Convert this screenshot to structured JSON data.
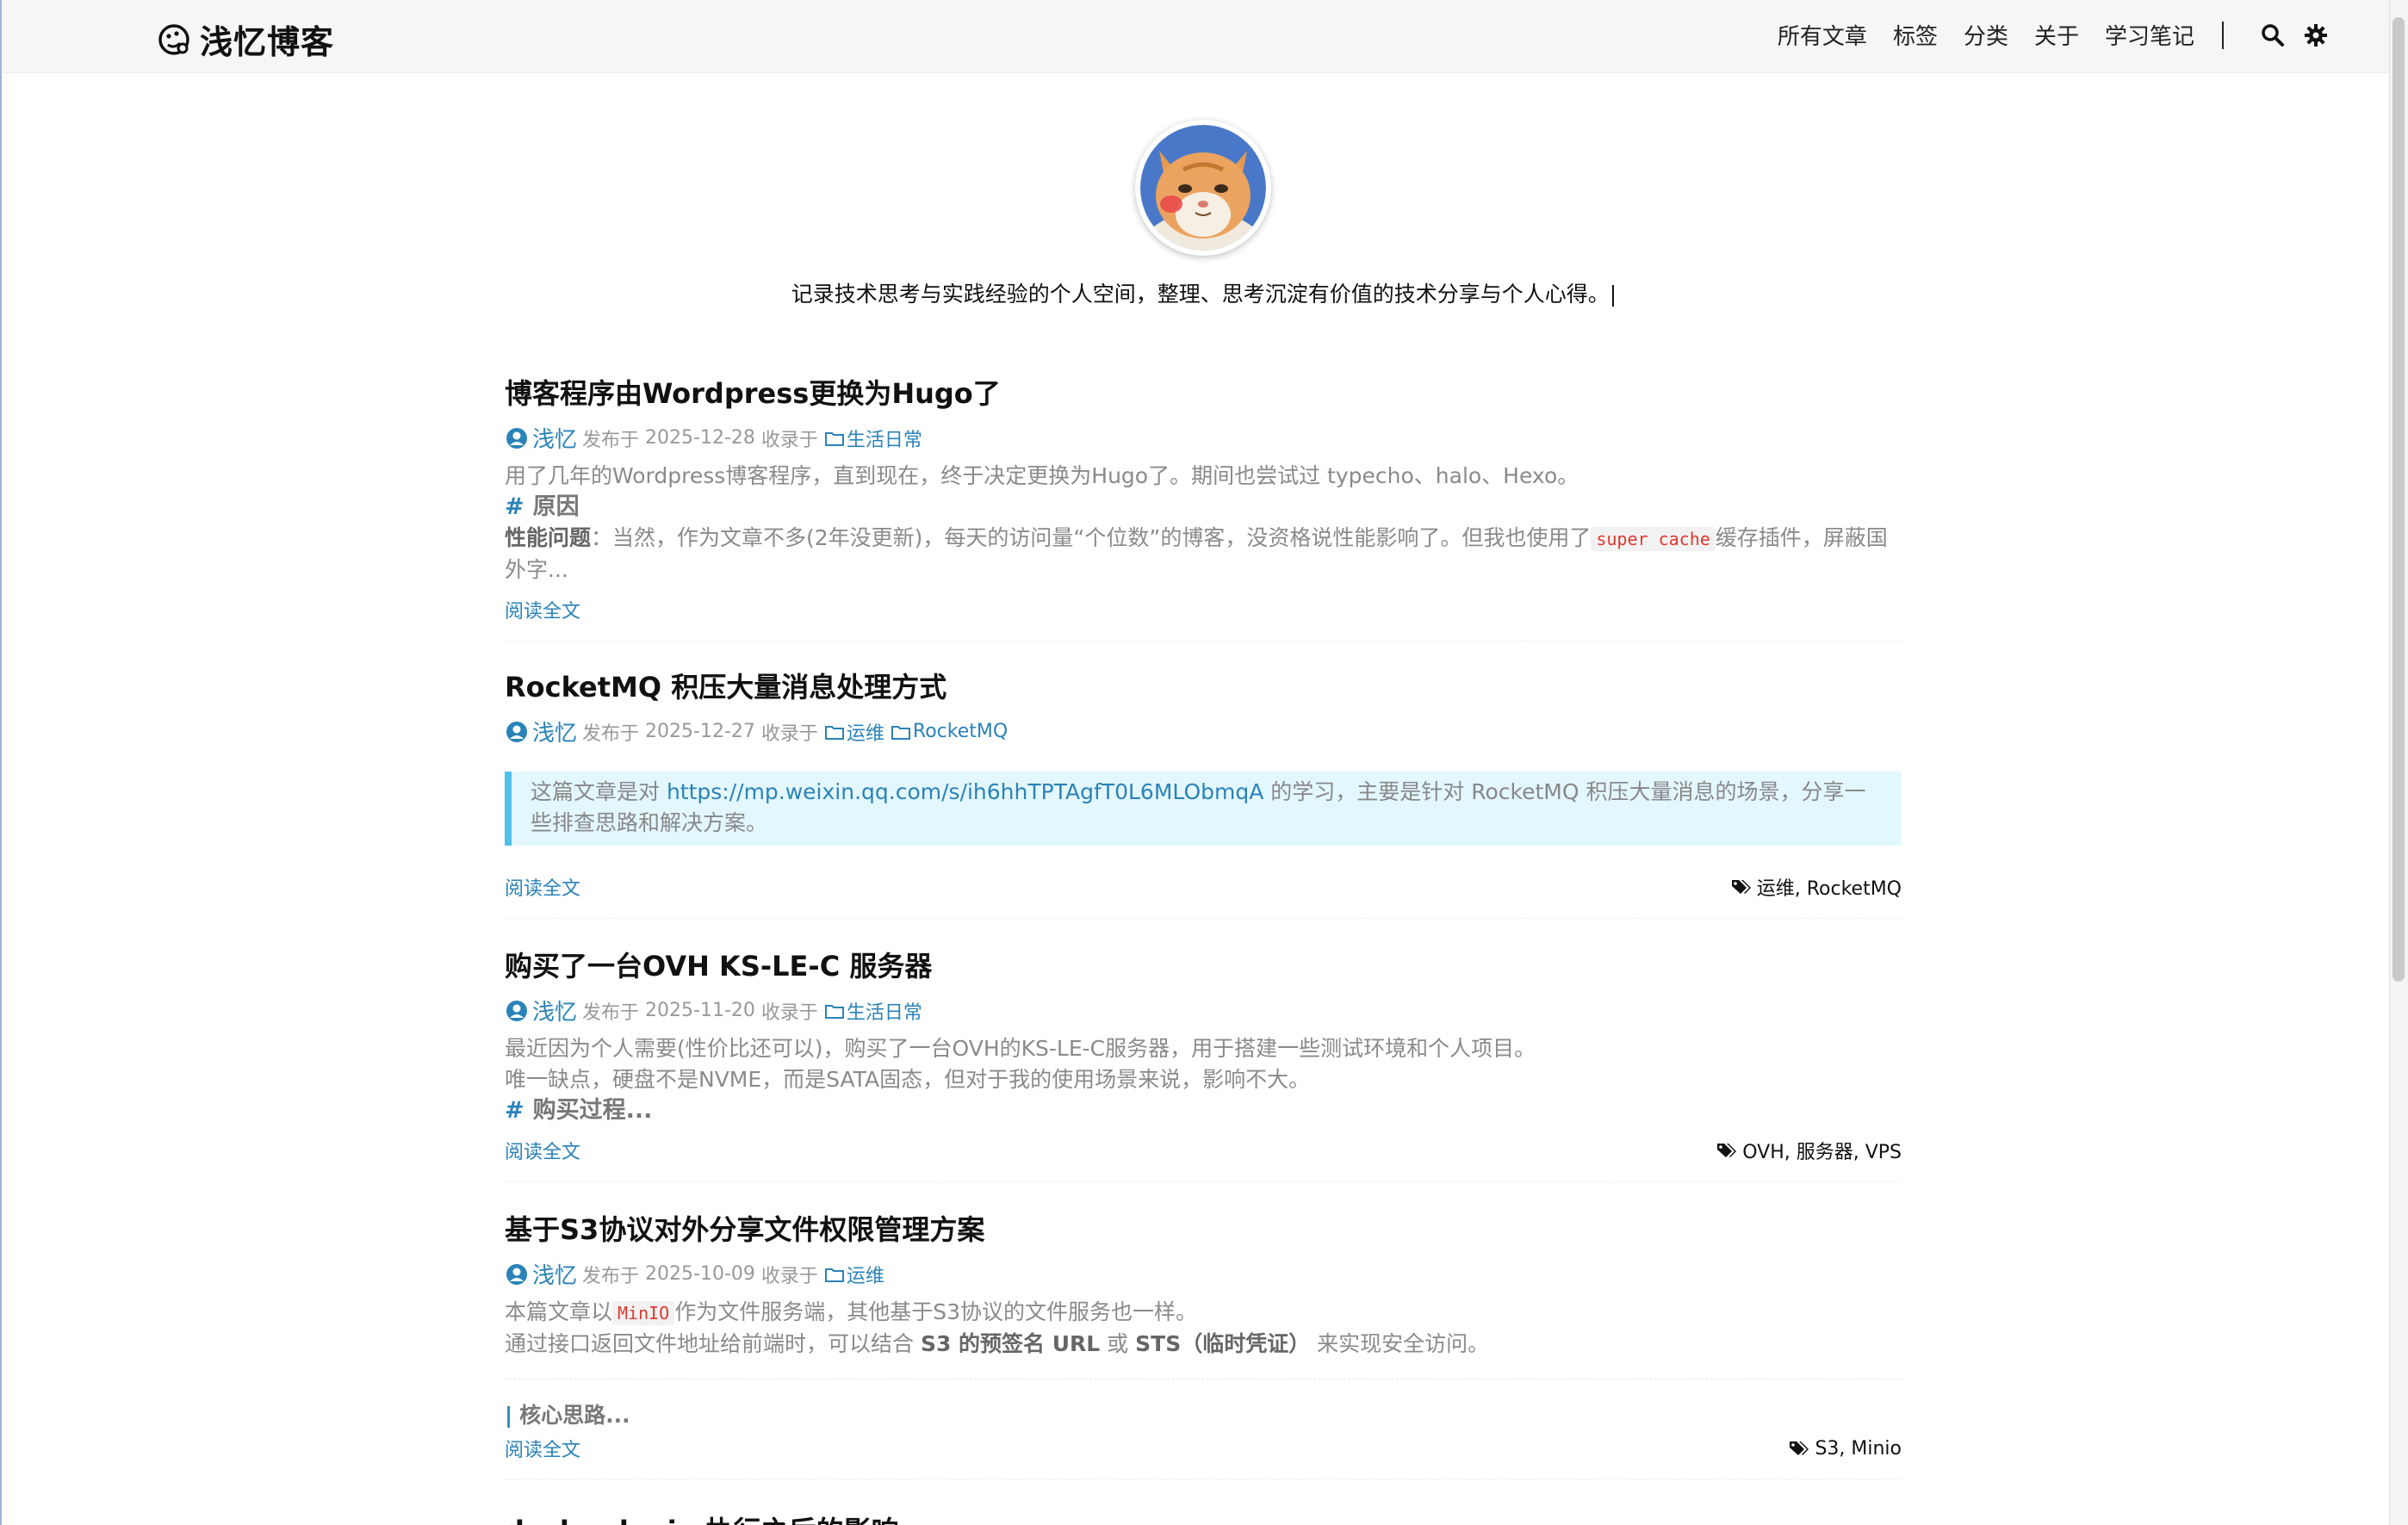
{
  "site": {
    "title": "浅忆博客",
    "motto": "记录技术思考与实践经验的个人空间，整理、思考沉淀有价值的技术分享与个人心得。|"
  },
  "nav": {
    "items": [
      "所有文章",
      "标签",
      "分类",
      "关于",
      "学习笔记"
    ],
    "search_icon": "search-icon",
    "theme_icon": "gear-icon"
  },
  "colors": {
    "accent": "#2a83b8",
    "notice_bg": "#e3f7fe",
    "notice_border": "#4fc1e9",
    "code": "#e0382f"
  },
  "common": {
    "read_more": "阅读全文",
    "published_at": "发布于",
    "included_in": "收录于"
  },
  "posts": [
    {
      "title": "博客程序由Wordpress更换为Hugo了",
      "author": "浅忆",
      "date": "2025-12-28",
      "categories": [
        "生活日常"
      ],
      "excerpt_p1": "用了几年的Wordpress博客程序，直到现在，终于决定更换为Hugo了。期间也尝试过 typecho、halo、Hexo。",
      "heading_hash": "#",
      "heading": "原因",
      "strong_label": "性能问题",
      "excerpt_p2_before": "：当然，作为文章不多(2年没更新)，每天的访问量“个位数”的博客，没资格说性能影响了。但我也使用了",
      "code": "super cache",
      "excerpt_p2_after": "缓存插件，屏蔽国外字...",
      "tags": ""
    },
    {
      "title": "RocketMQ 积压大量消息处理方式",
      "author": "浅忆",
      "date": "2025-12-27",
      "categories": [
        "运维",
        "RocketMQ"
      ],
      "notice_before": "这篇文章是对 ",
      "notice_link": "https://mp.weixin.qq.com/s/ih6hhTPTAgfT0L6MLObmqA",
      "notice_after": " 的学习，主要是针对 RocketMQ 积压大量消息的场景，分享一些排查思路和解决方案。",
      "tags": "运维, RocketMQ"
    },
    {
      "title": "购买了一台OVH KS-LE-C 服务器",
      "author": "浅忆",
      "date": "2025-11-20",
      "categories": [
        "生活日常"
      ],
      "excerpt_p1": "最近因为个人需要(性价比还可以)，购买了一台OVH的KS-LE-C服务器，用于搭建一些测试环境和个人项目。",
      "excerpt_p2": "唯一缺点，硬盘不是NVME，而是SATA固态，但对于我的使用场景来说，影响不大。",
      "heading_hash": "#",
      "heading": "购买过程...",
      "tags": "OVH, 服务器, VPS"
    },
    {
      "title": "基于S3协议对外分享文件权限管理方案",
      "author": "浅忆",
      "date": "2025-10-09",
      "categories": [
        "运维"
      ],
      "excerpt_p1_before": "本篇文章以",
      "code": "MinIO",
      "excerpt_p1_after": "作为文件服务端，其他基于S3协议的文件服务也一样。",
      "excerpt_p2_before": "通过接口返回文件地址给前端时，可以结合 ",
      "strong_label": "S3 的预签名 URL",
      "excerpt_p2_mid": " 或 ",
      "strong_label2": "STS（临时凭证）",
      "excerpt_p2_after": " 来实现安全访问。",
      "h3_bar": "|",
      "h3": "核心思路...",
      "tags": "S3, Minio"
    },
    {
      "title": "docker login 执行之后的影响"
    }
  ]
}
